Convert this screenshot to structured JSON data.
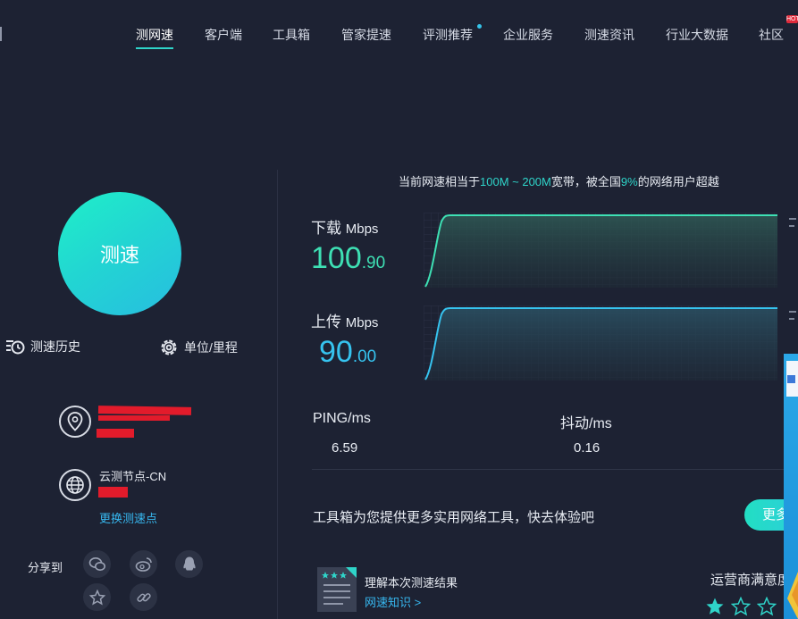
{
  "nav": {
    "items": [
      {
        "label": "测网速",
        "active": true
      },
      {
        "label": "客户端"
      },
      {
        "label": "工具箱"
      },
      {
        "label": "管家提速"
      },
      {
        "label": "评测推荐",
        "dot": true
      },
      {
        "label": "企业服务"
      },
      {
        "label": "测速资讯"
      },
      {
        "label": "行业大数据"
      },
      {
        "label": "社区"
      }
    ],
    "hot_badge": "HOT"
  },
  "left": {
    "speed_button": "测速",
    "history_label": "测速历史",
    "unit_label": "单位/里程",
    "node_name": "云测节点-CN",
    "change_node": "更换测速点",
    "share_label": "分享到"
  },
  "summary": {
    "prefix": "当前网速相当于",
    "bandwidth": "100M ~ 200M",
    "middle": "宽带，被全国",
    "percent": "9%",
    "suffix": "的网络用户超越"
  },
  "download": {
    "label": "下载",
    "unit": "Mbps",
    "value_int": "100",
    "value_dec": ".90",
    "color": "#3ee0b4"
  },
  "upload": {
    "label": "上传",
    "unit": "Mbps",
    "value_int": "90",
    "value_dec": ".00",
    "color": "#36c3ef"
  },
  "stats": {
    "ping_label": "PING/ms",
    "ping_value": "6.59",
    "jitter_label": "抖动/ms",
    "jitter_value": "0.16"
  },
  "toolbox": {
    "text": "工具箱为您提供更多实用网络工具，快去体验吧",
    "more_button": "更多"
  },
  "knowledge": {
    "title": "理解本次测速结果",
    "link": "网速知识 >"
  },
  "carrier": {
    "title": "运营商满意度",
    "stars_filled": 1,
    "stars_total": 3
  },
  "colors": {
    "background": "#1d2233",
    "accent": "#2fd4c9",
    "link": "#37b8f0",
    "redaction": "#e21b2b"
  }
}
